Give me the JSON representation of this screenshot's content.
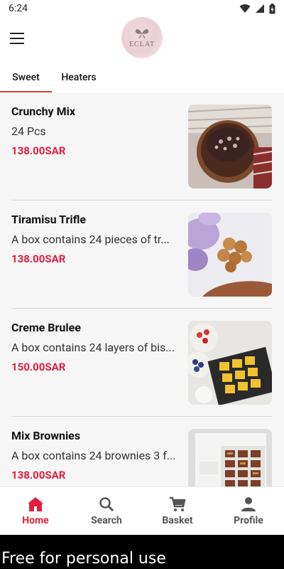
{
  "status": {
    "time": "6:24"
  },
  "app": {
    "logo_text": "ECLAT"
  },
  "tabs": [
    {
      "label": "Sweet",
      "active": true
    },
    {
      "label": "Heaters",
      "active": false
    }
  ],
  "items": [
    {
      "name": "Crunchy Mix",
      "desc": "24 Pcs",
      "price": "138.00SAR"
    },
    {
      "name": "Tiramisu Trifle",
      "desc": "A box contains 24 pieces of tr...",
      "price": "138.00SAR"
    },
    {
      "name": "Creme Brulee",
      "desc": "A box contains 24 layers of bis...",
      "price": "150.00SAR"
    },
    {
      "name": "Mix Brownies",
      "desc": "A box contains 24 brownies 3 f...",
      "price": "138.00SAR"
    }
  ],
  "nav": [
    {
      "label": "Home",
      "icon": "home-icon",
      "active": true
    },
    {
      "label": "Search",
      "icon": "search-icon",
      "active": false
    },
    {
      "label": "Basket",
      "icon": "cart-icon",
      "active": false
    },
    {
      "label": "Profile",
      "icon": "person-icon",
      "active": false
    }
  ],
  "watermark": "Free for personal use",
  "colors": {
    "accent": "#e41e3f",
    "tab_indicator": "#e53935"
  }
}
